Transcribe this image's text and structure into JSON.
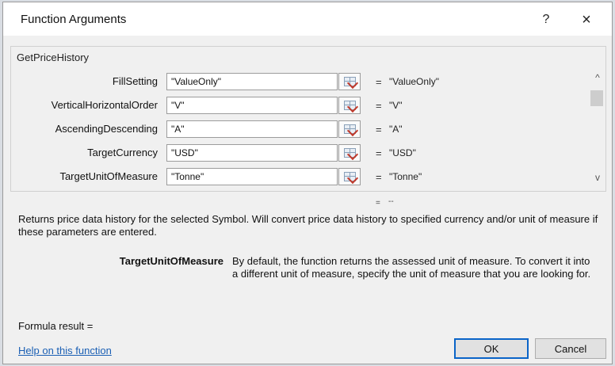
{
  "dialog": {
    "title": "Function Arguments",
    "help_glyph": "?",
    "close_glyph": "×"
  },
  "function": {
    "name": "GetPriceHistory",
    "arguments": [
      {
        "label": "FillSetting",
        "value": "\"ValueOnly\"",
        "result": "\"ValueOnly\""
      },
      {
        "label": "VerticalHorizontalOrder",
        "value": "\"V\"",
        "result": "\"V\""
      },
      {
        "label": "AscendingDescending",
        "value": "\"A\"",
        "result": "\"A\""
      },
      {
        "label": "TargetCurrency",
        "value": "\"USD\"",
        "result": "\"USD\""
      },
      {
        "label": "TargetUnitOfMeasure",
        "value": "\"Tonne\"",
        "result": "\"Tonne\""
      }
    ],
    "equals": "=",
    "final_result": "--",
    "description": "Returns price data history for the selected Symbol. Will convert price data history to specified currency and/or unit of measure if these parameters are entered.",
    "param_name": "TargetUnitOfMeasure",
    "param_description": "By default, the function returns the assessed unit of measure. To convert it into a different unit of measure, specify the unit of measure that you are looking for."
  },
  "scroll": {
    "up_glyph": "^",
    "down_glyph": "v"
  },
  "footer": {
    "formula_result_label": "Formula result =",
    "help_link": "Help on this function",
    "ok_label": "OK",
    "cancel_label": "Cancel"
  },
  "icons": {
    "reference": "collapse-range-icon"
  },
  "colors": {
    "link": "#1a5fb4",
    "ok_border": "#0a64c8"
  }
}
